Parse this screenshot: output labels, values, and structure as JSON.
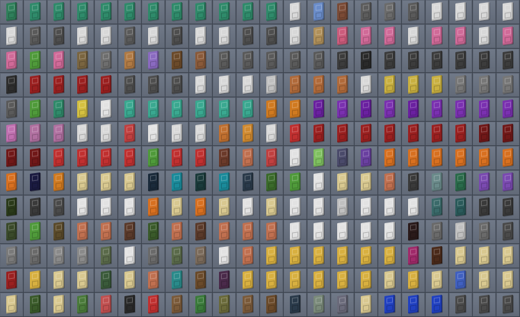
{
  "inventory": {
    "columns": 22,
    "rows": 13,
    "slots": [
      [
        "#2f7f5a",
        "#2f8a6a",
        "#2f8a6a",
        "#2f8a6a",
        "#2f8a6a",
        "#2f8a6a",
        "#2f8a6a",
        "#2f8a6a",
        "#2f8a6a",
        "#2f8a6a",
        "#2f8a6a",
        "#2f8a6a",
        "#d9d9d9",
        "#6a8cc9",
        "#7a4a35",
        "#5c5c5c",
        "#6b6b6b",
        "#5a5a5a",
        "#d8d8d8",
        "#d8d8d8",
        "#d8d8d8",
        "#d8d8d8"
      ],
      [
        "#d8d8d8",
        "#5a5a5a",
        "#4e4e4e",
        "#d8d8d8",
        "#d8d8d8",
        "#5a5a5a",
        "#d8d8d8",
        "#4e4e4e",
        "#d8d8d8",
        "#d8d8d8",
        "#4e4e4e",
        "#4e4e4e",
        "#d8d8d8",
        "#b0905a",
        "#cc5c7c",
        "#d06a98",
        "#d06a98",
        "#d8d8d8",
        "#d06a98",
        "#d06a98",
        "#d8d8d8",
        "#d06a98"
      ],
      [
        "#d06a98",
        "#4f9a3a",
        "#d06a98",
        "#7a6540",
        "#6e6e6e",
        "#b07a44",
        "#8a6ac0",
        "#6b4a2a",
        "#8a5a3a",
        "#5a5a5a",
        "#5a5a5a",
        "#5a5a5a",
        "#5a5a5a",
        "#5a5a5a",
        "#3c3c3c",
        "#2a2a2a",
        "#3c3c3c",
        "#3c3c3c",
        "#3c3c3c",
        "#3c3c3c",
        "#3c3c3c",
        "#3c3c3c"
      ],
      [
        "#2e2e2e",
        "#9a2020",
        "#9a2020",
        "#9a2020",
        "#9a2020",
        "#4e4e4e",
        "#4e4e4e",
        "#4e4e4e",
        "#d8d8d8",
        "#d8d8d8",
        "#d8d8d8",
        "#c0c0c0",
        "#b06a3a",
        "#b06a3a",
        "#b06a3a",
        "#d8d8d8",
        "#c9b040",
        "#c9b040",
        "#c9b040",
        "#777777",
        "#777777",
        "#777777"
      ],
      [
        "#5a5a5a",
        "#4f9a3a",
        "#2f8a6a",
        "#d4c040",
        "#e2e2e2",
        "#3aa890",
        "#3aa890",
        "#3aa890",
        "#3aa890",
        "#3aa890",
        "#3aa890",
        "#d07a20",
        "#d07a20",
        "#6a20a0",
        "#7a30b0",
        "#6a20a0",
        "#7a30b0",
        "#6a20a0",
        "#7a30b0",
        "#7a30b0",
        "#7a30b0",
        "#7a30b0"
      ],
      [
        "#c070b0",
        "#b070a0",
        "#b070a0",
        "#d8d8d8",
        "#d8d8d8",
        "#c04040",
        "#e2e2e2",
        "#d8d8d8",
        "#d8d8d8",
        "#c07030",
        "#d08a30",
        "#d8d8d8",
        "#c03030",
        "#9a2020",
        "#9a2020",
        "#9a2020",
        "#9a2020",
        "#9a2020",
        "#9a2020",
        "#9a2020",
        "#701818",
        "#701818"
      ],
      [
        "#701818",
        "#701818",
        "#c03030",
        "#c03030",
        "#c03030",
        "#c03030",
        "#4f9a3a",
        "#c03030",
        "#c03030",
        "#6b3a2a",
        "#c07050",
        "#c04040",
        "#e2e2e2",
        "#7fc060",
        "#4a4a6a",
        "#6a40a0",
        "#d87020",
        "#d87020",
        "#d87020",
        "#d87020",
        "#d87020",
        "#d87020"
      ],
      [
        "#d87020",
        "#1a1a40",
        "#d07a20",
        "#d8c890",
        "#d8c890",
        "#d8c890",
        "#1a2a3a",
        "#1a8a9a",
        "#1a3a3a",
        "#1a8a9a",
        "#2a3a4a",
        "#3a6a2a",
        "#4f9a3a",
        "#e2e2e2",
        "#d8c890",
        "#d8c890",
        "#c07050",
        "#3a3a3a",
        "#6a8a8a",
        "#2a6a4a",
        "#7a4ab0",
        "#7a4ab0"
      ],
      [
        "#2a3a1a",
        "#3a3a3a",
        "#4a4a4a",
        "#e2e2e2",
        "#e2e2e2",
        "#e2e2e2",
        "#d87020",
        "#d8c890",
        "#d87020",
        "#d8c890",
        "#e2e2e2",
        "#d8c890",
        "#e2e2e2",
        "#e2e2e2",
        "#c0c0c0",
        "#e2e2e2",
        "#e2e2e2",
        "#e2e2e2",
        "#3a6a6a",
        "#2a5a5a",
        "#3a3a3a",
        "#3a3a3a"
      ],
      [
        "#3a4a2a",
        "#4f9a3a",
        "#5a4a2a",
        "#c07050",
        "#c07050",
        "#5a3a2a",
        "#3a5a2a",
        "#c07050",
        "#5a3a2a",
        "#c07050",
        "#c07050",
        "#c07050",
        "#e2e2e2",
        "#e2e2e2",
        "#e2e2e2",
        "#e2e2e2",
        "#e2e2e2",
        "#2a1a1a",
        "#6a6a6a",
        "#c0c0c0",
        "#6a6a6a",
        "#4a4a4a"
      ],
      [
        "#7a7a7a",
        "#6a6a6a",
        "#8a8a8a",
        "#8a8a8a",
        "#5a6a4a",
        "#e2e2e2",
        "#6a6a6a",
        "#5a6a4a",
        "#7a6a5a",
        "#e2e2e2",
        "#c07050",
        "#d8b040",
        "#d8b040",
        "#d8b040",
        "#d8b040",
        "#d8b040",
        "#d8b040",
        "#a02a6a",
        "#4a2a1a",
        "#d8c890",
        "#d8c890",
        "#d8c890"
      ],
      [
        "#9a2020",
        "#d8b040",
        "#d8c890",
        "#d8c890",
        "#3a5a3a",
        "#d8c890",
        "#c07050",
        "#2a8a8a",
        "#6a4a2a",
        "#4a2a4a",
        "#d8b040",
        "#d8b040",
        "#d8b040",
        "#d8b040",
        "#d8b040",
        "#d8b040",
        "#d8c890",
        "#d8b040",
        "#d8c890",
        "#4060c0",
        "#d8c890",
        "#d8c890"
      ],
      [
        "#d8c890",
        "#3a5a2a",
        "#d8c890",
        "#4a7a3a",
        "#c05050",
        "#2a2a2a",
        "#c03030",
        "#7a5a3a",
        "#3a7a3a",
        "#6a6a3a",
        "#7a5a3a",
        "#6a4a2a",
        "#2a3a4a",
        "#7a8a7a",
        "#6a6a7a",
        "#d8c890",
        "#2040c0",
        "#2040c0",
        "#2040c0",
        "#4a4a4a",
        "#4a4a4a",
        "#4a4a4a"
      ]
    ]
  }
}
